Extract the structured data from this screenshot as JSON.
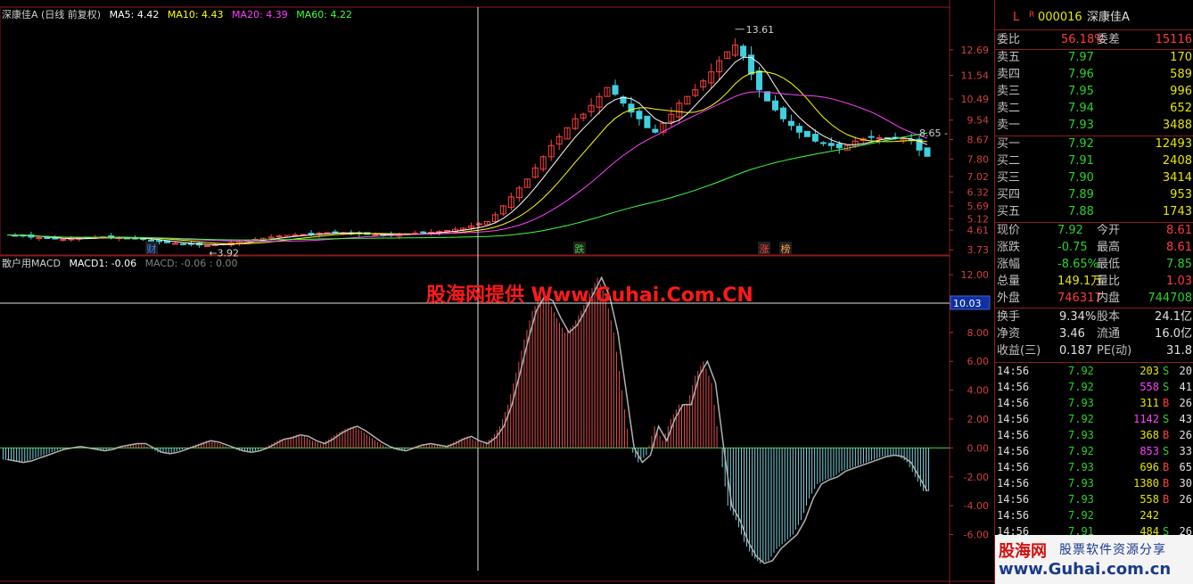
{
  "main_legend": {
    "title": "深康佳A (日线 前复权)",
    "ma5": "MA5: 4.42",
    "ma10": "MA10: 4.43",
    "ma20": "MA20: 4.39",
    "ma60": "MA60: 4.22",
    "ma5_color": "#ffffff",
    "ma10_color": "#ffff00",
    "ma20_color": "#ff40ff",
    "ma60_color": "#40ff40"
  },
  "price_axis": {
    "labels": [
      "12.69",
      "11.54",
      "10.49",
      "9.54",
      "8.67",
      "7.80",
      "7.02",
      "6.32",
      "5.69",
      "5.12",
      "4.61",
      "3.73"
    ]
  },
  "annotations": {
    "high": "13.61",
    "low": "3.92",
    "last": "8.65",
    "markers": [
      "财",
      "跌",
      "涨",
      "榜"
    ]
  },
  "macd_legend": {
    "title": "散户用MACD",
    "macd1": "MACD1: -0.06",
    "macd": "MACD: -0.06 : 0.00"
  },
  "macd_axis": {
    "labels": [
      "12.00",
      "10.00",
      "8.00",
      "6.00",
      "4.00",
      "2.00",
      "0.00",
      "-2.00",
      "-4.00",
      "-6.00"
    ],
    "cursor_value": "10.03"
  },
  "watermark": "股海网提供 Www.Guhai.Com.CN",
  "header": {
    "market": "L",
    "flag": "R",
    "code": "000016",
    "name": "深康佳A"
  },
  "ratio": {
    "wb_label": "委比",
    "wb_value": "56.18%",
    "wc_label": "委差",
    "wc_value": "15116"
  },
  "asks": [
    {
      "label": "卖五",
      "price": "7.97",
      "vol": "170"
    },
    {
      "label": "卖四",
      "price": "7.96",
      "vol": "589"
    },
    {
      "label": "卖三",
      "price": "7.95",
      "vol": "996"
    },
    {
      "label": "卖二",
      "price": "7.94",
      "vol": "652"
    },
    {
      "label": "卖一",
      "price": "7.93",
      "vol": "3488"
    }
  ],
  "bids": [
    {
      "label": "买一",
      "price": "7.92",
      "vol": "12493"
    },
    {
      "label": "买二",
      "price": "7.91",
      "vol": "2408"
    },
    {
      "label": "买三",
      "price": "7.90",
      "vol": "3414"
    },
    {
      "label": "买四",
      "price": "7.89",
      "vol": "953"
    },
    {
      "label": "买五",
      "price": "7.88",
      "vol": "1743"
    }
  ],
  "quote": [
    {
      "l1": "现价",
      "v1": "7.92",
      "l2": "今开",
      "v2": "8.61"
    },
    {
      "l1": "涨跌",
      "v1": "-0.75",
      "l2": "最高",
      "v2": "8.61"
    },
    {
      "l1": "涨幅",
      "v1": "-8.65%",
      "l2": "最低",
      "v2": "7.85"
    },
    {
      "l1": "总量",
      "v1": "149.1万",
      "l2": "量比",
      "v2": "1.03"
    },
    {
      "l1": "外盘",
      "v1": "746317",
      "l2": "内盘",
      "v2": "744708"
    }
  ],
  "fundamentals": [
    {
      "l1": "换手",
      "v1": "9.34%",
      "l2": "股本",
      "v2": "24.1亿"
    },
    {
      "l1": "净资",
      "v1": "3.46",
      "l2": "流通",
      "v2": "16.0亿"
    },
    {
      "l1": "收益(三)",
      "v1": "0.187",
      "l2": "PE(动)",
      "v2": "31.8"
    }
  ],
  "ticks": [
    {
      "time": "14:56",
      "price": "7.92",
      "vol": "203",
      "side": "S",
      "num": "20"
    },
    {
      "time": "14:56",
      "price": "7.92",
      "vol": "558",
      "side": "S",
      "num": "41"
    },
    {
      "time": "14:56",
      "price": "7.93",
      "vol": "311",
      "side": "B",
      "num": "26"
    },
    {
      "time": "14:56",
      "price": "7.92",
      "vol": "1142",
      "side": "S",
      "num": "43"
    },
    {
      "time": "14:56",
      "price": "7.93",
      "vol": "368",
      "side": "B",
      "num": "26"
    },
    {
      "time": "14:56",
      "price": "7.92",
      "vol": "853",
      "side": "S",
      "num": "33"
    },
    {
      "time": "14:56",
      "price": "7.93",
      "vol": "696",
      "side": "B",
      "num": "65"
    },
    {
      "time": "14:56",
      "price": "7.93",
      "vol": "1380",
      "side": "B",
      "num": "30"
    },
    {
      "time": "14:56",
      "price": "7.93",
      "vol": "558",
      "side": "B",
      "num": "26"
    },
    {
      "time": "14:56",
      "price": "7.92",
      "vol": "242",
      "side": "",
      "num": ""
    },
    {
      "time": "14:56",
      "price": "7.91",
      "vol": "484",
      "side": "S",
      "num": "26"
    }
  ],
  "logo": {
    "name": "股海网",
    "slogan": "股票软件资源分享",
    "url": "www.Guhai.com.cn"
  },
  "chart_data": {
    "type": "candlestick",
    "close_series": [
      4.4,
      4.38,
      4.35,
      4.3,
      4.28,
      4.25,
      4.22,
      4.2,
      4.22,
      4.25,
      4.28,
      4.3,
      4.32,
      4.3,
      4.28,
      4.26,
      4.22,
      4.2,
      4.15,
      4.1,
      4.05,
      4.02,
      4.0,
      3.98,
      3.95,
      3.92,
      3.96,
      4.0,
      4.05,
      4.1,
      4.15,
      4.2,
      4.25,
      4.3,
      4.35,
      4.38,
      4.4,
      4.42,
      4.45,
      4.48,
      4.5,
      4.52,
      4.5,
      4.48,
      4.45,
      4.42,
      4.4,
      4.38,
      4.4,
      4.42,
      4.45,
      4.48,
      4.5,
      4.52,
      4.55,
      4.6,
      4.65,
      4.7,
      4.8,
      4.9,
      5.0,
      5.3,
      5.7,
      6.1,
      6.5,
      6.9,
      7.4,
      7.9,
      8.4,
      8.8,
      9.2,
      9.6,
      9.8,
      10.2,
      10.6,
      11.0,
      10.7,
      10.3,
      9.9,
      9.6,
      9.2,
      9.0,
      9.4,
      9.8,
      10.3,
      10.6,
      10.9,
      11.3,
      11.7,
      12.2,
      12.6,
      12.9,
      12.4,
      11.6,
      10.9,
      10.4,
      10.0,
      9.6,
      9.3,
      9.0,
      8.8,
      8.6,
      8.5,
      8.4,
      8.3,
      8.4,
      8.6,
      8.7,
      8.8,
      8.75,
      8.7,
      8.72,
      8.7,
      8.65,
      8.2,
      7.92
    ],
    "price_range": [
      3.5,
      14.2
    ],
    "macd_series": [
      -0.8,
      -0.9,
      -1.0,
      -0.9,
      -0.7,
      -0.5,
      -0.3,
      -0.1,
      0.0,
      0.1,
      0.0,
      -0.1,
      -0.2,
      -0.1,
      0.1,
      0.2,
      0.3,
      0.3,
      0.0,
      -0.3,
      -0.4,
      -0.3,
      -0.1,
      0.1,
      0.3,
      0.5,
      0.4,
      0.2,
      0.0,
      -0.2,
      -0.3,
      -0.2,
      0.0,
      0.3,
      0.6,
      0.7,
      0.9,
      0.8,
      0.5,
      0.3,
      0.6,
      1.0,
      1.3,
      1.5,
      1.2,
      0.8,
      0.4,
      0.1,
      -0.1,
      -0.2,
      0.0,
      0.2,
      0.3,
      0.2,
      0.1,
      0.3,
      0.6,
      0.8,
      0.5,
      0.3,
      0.7,
      1.5,
      3.0,
      5.2,
      7.5,
      9.5,
      10.5,
      10.2,
      9.0,
      8.0,
      8.5,
      9.5,
      10.7,
      11.8,
      10.5,
      8.0,
      4.0,
      0.0,
      -1.0,
      -0.5,
      1.5,
      0.5,
      2.0,
      3.0,
      3.0,
      5.0,
      6.0,
      4.5,
      0.0,
      -4.0,
      -5.0,
      -6.5,
      -7.5,
      -8.0,
      -7.8,
      -7.0,
      -6.5,
      -6.0,
      -5.0,
      -3.5,
      -2.5,
      -2.2,
      -2.0,
      -1.6,
      -1.4,
      -1.2,
      -1.0,
      -0.8,
      -0.6,
      -0.5,
      -0.6,
      -1.0,
      -2.0,
      -3.0
    ],
    "macd_range": [
      -8.5,
      12.5
    ]
  }
}
